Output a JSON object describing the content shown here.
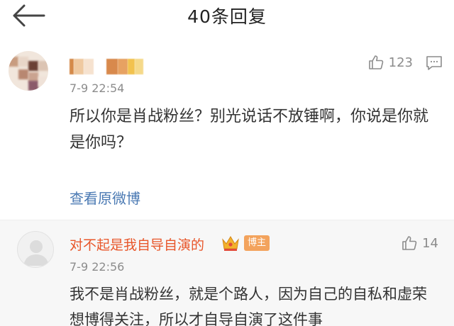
{
  "header": {
    "title": "40条回复",
    "back_icon": "arrow-left-icon"
  },
  "comments": [
    {
      "time": "7-9 22:54",
      "likes": "123",
      "text": "所以你是肖战粉丝？别光说话不放锤啊，你说是你就是你吗？",
      "link": "查看原微博",
      "icons": [
        "thumbs-up-icon",
        "reply-icon"
      ]
    },
    {
      "username": "对不起是我自导自演的",
      "badge": "博主",
      "time": "7-9 22:56",
      "likes": "14",
      "text": "我不是肖战粉丝，就是个路人，因为自己的自私和虚荣想博得关注，所以才自导自演了这件事",
      "icons": [
        "crown-icon",
        "thumbs-up-icon"
      ]
    }
  ],
  "colors": {
    "username_accent": "#e8562a",
    "badge": "#f3a35d",
    "link": "#4a79b3"
  }
}
